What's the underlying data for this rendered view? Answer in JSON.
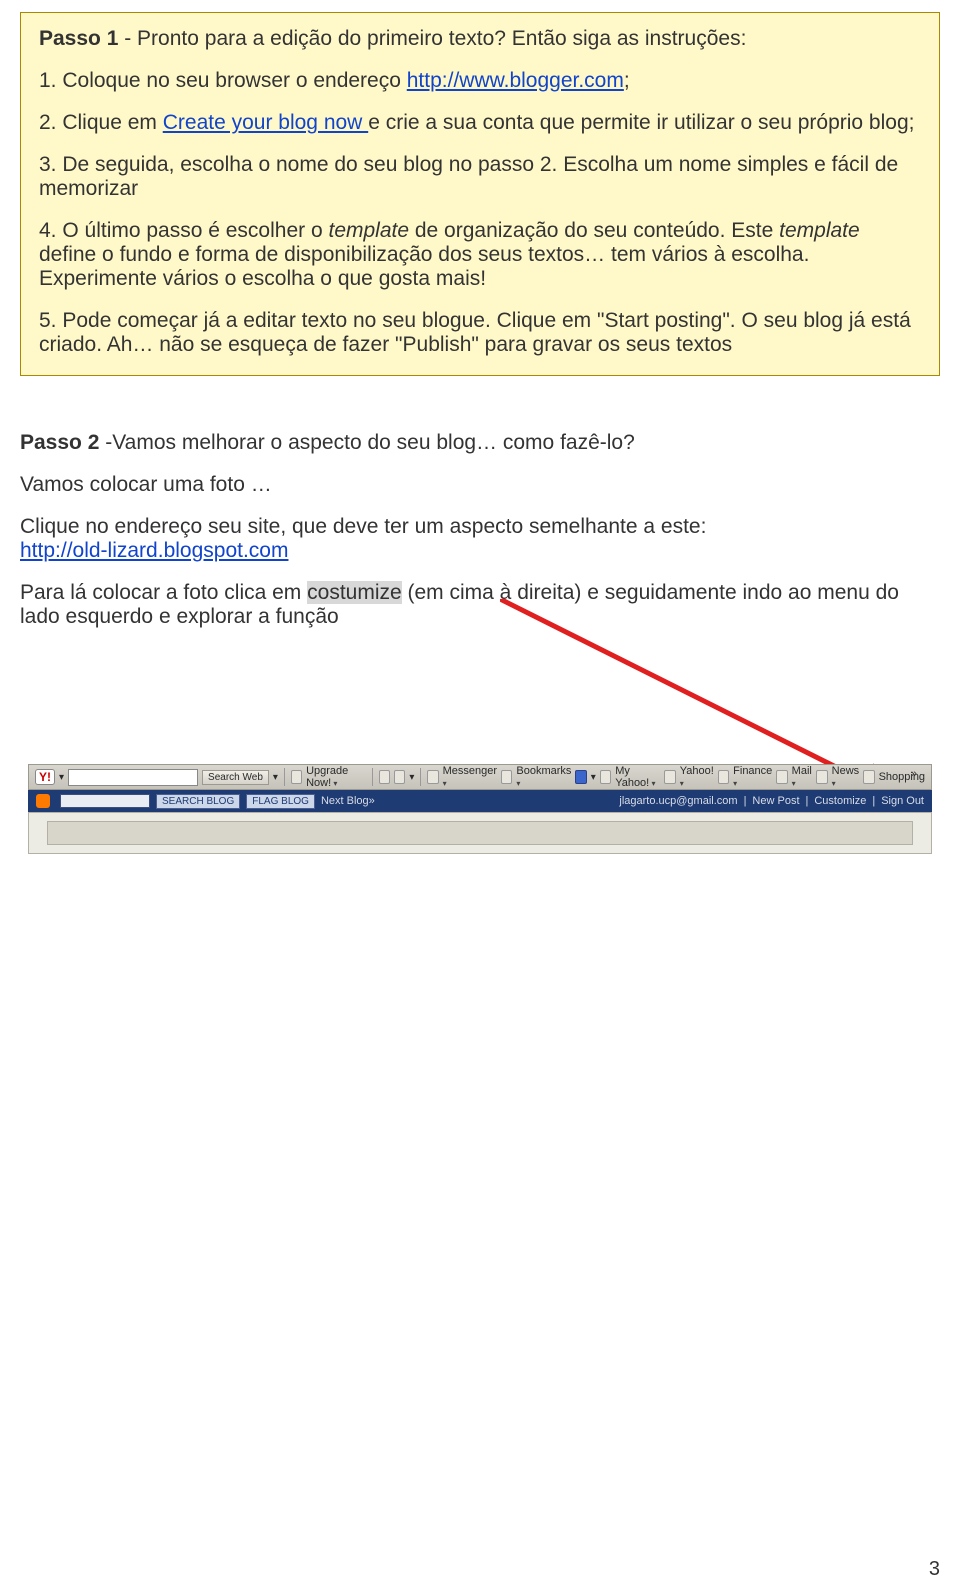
{
  "passo1": {
    "title_bold": "Passo 1",
    "title_rest": " - Pronto para a edição do primeiro texto? Então siga as instruções:",
    "item1_prefix": "1. Coloque no seu browser o endereço ",
    "item1_link": "http://www.blogger.com",
    "item1_suffix": ";",
    "item2_prefix": "2. Clique em ",
    "item2_link": "Create your blog now ",
    "item2_suffix": " e crie a sua conta que permite ir utilizar o seu próprio blog;",
    "item3": "3. De seguida, escolha o nome do seu blog no passo 2. Escolha um nome simples e fácil de memorizar",
    "item4_a": "4. O último passo é escolher o ",
    "item4_b": "template",
    "item4_c": " de organização do seu conteúdo. Este ",
    "item4_d": "template",
    "item4_e": " define o fundo e forma de disponibilização dos seus textos… tem vários à escolha. Experimente vários o escolha o que gosta mais!",
    "item5": "5. Pode começar já a editar texto no seu blogue. Clique em \"Start posting\". O seu blog já está criado. Ah… não se esqueça de fazer \"Publish\" para gravar os seus textos"
  },
  "passo2": {
    "title_bold": "Passo 2 ",
    "title_rest": "-Vamos melhorar o aspecto do seu blog… como fazê-lo?",
    "p1": "Vamos colocar uma foto …",
    "p2_a": "Clique no endereço seu site, que deve ter um aspecto semelhante a este: ",
    "p2_link": "http://old-lizard.blogspot.com",
    "p3_a": "Para lá colocar a foto clica em ",
    "p3_hl": "costumize",
    "p3_b": " (em cima à direita) e seguidamente indo ao menu do lado esquerdo e explorar a função"
  },
  "toolbar": {
    "yahoo": "Y!",
    "search_web": "Search Web",
    "upgrade": "Upgrade Now!",
    "messenger": "Messenger",
    "bookmarks": "Bookmarks",
    "myyahoo": "My Yahoo!",
    "yahoo_link": "Yahoo!",
    "finance": "Finance",
    "mail": "Mail",
    "news": "News",
    "shopping": "Shopping",
    "chevron": "»"
  },
  "navbar": {
    "search_blog": "SEARCH BLOG",
    "flag_blog": "FLAG BLOG",
    "next_blog": "Next Blog»",
    "email": "jlagarto.ucp@gmail.com",
    "new_post": "New Post",
    "customize": "Customize",
    "sign_out": "Sign Out"
  },
  "page_number": "3"
}
